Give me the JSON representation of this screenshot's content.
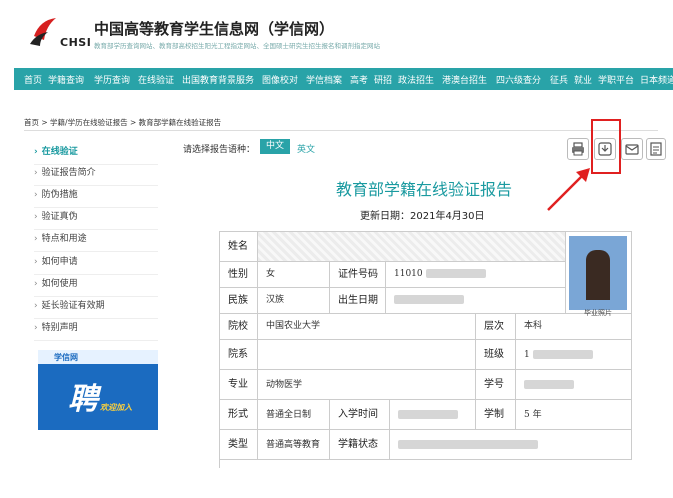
{
  "header": {
    "logo_text": "CHSI",
    "title": "中国高等教育学生信息网（学信网）",
    "subtitle": "教育部学历查询网站、教育部高校招生阳光工程指定网站、全国硕士研究生招生报名和调剂指定网站"
  },
  "nav": {
    "items": [
      "首页",
      "学籍查询",
      "学历查询",
      "在线验证",
      "出国教育背景服务",
      "图像校对",
      "学信档案",
      "高考",
      "研招",
      "政法招生",
      "港澳台招生",
      "四六级查分",
      "征兵",
      "就业",
      "学职平台",
      "日本频道"
    ]
  },
  "breadcrumb": "首页 > 学籍/学历在线验证报告 > 教育部学籍在线验证报告",
  "sidebar": {
    "items": [
      "在线验证",
      "验证报告简介",
      "防伪措施",
      "验证真伪",
      "特点和用途",
      "如何申请",
      "如何使用",
      "延长验证有效期",
      "特别声明"
    ],
    "banner_brand": "学信网",
    "banner_big": "聘",
    "banner_join": "欢迎加入"
  },
  "lang": {
    "label": "请选择报告语种：",
    "zh": "中文",
    "en": "英文"
  },
  "tools": {
    "print": "printer-icon",
    "download": "download-icon",
    "mail": "mail-icon",
    "more": "document-icon"
  },
  "report": {
    "title": "教育部学籍在线验证报告",
    "update_date": "更新日期：2021年4月30日"
  },
  "table": {
    "name_label": "姓名",
    "gender_label": "性别",
    "gender_value": "女",
    "id_label": "证件号码",
    "id_value": "11010",
    "ethnic_label": "民族",
    "ethnic_value": "汉族",
    "birth_label": "出生日期",
    "school_label": "院校",
    "school_value": "中国农业大学",
    "level_label": "层次",
    "level_value": "本科",
    "dept_label": "院系",
    "class_label": "班级",
    "class_value": "1",
    "major_label": "专业",
    "major_value": "动物医学",
    "stuno_label": "学号",
    "form_label": "形式",
    "form_value": "普通全日制",
    "entry_label": "入学时间",
    "duration_label": "学制",
    "duration_value": "5 年",
    "type_label": "类型",
    "type_value": "普通高等教育",
    "status_label": "学籍状态",
    "photo_caption": "毕业照片"
  },
  "colors": {
    "accent": "#29a3a8",
    "highlight": "#e02020",
    "arrow": "#e02020"
  }
}
